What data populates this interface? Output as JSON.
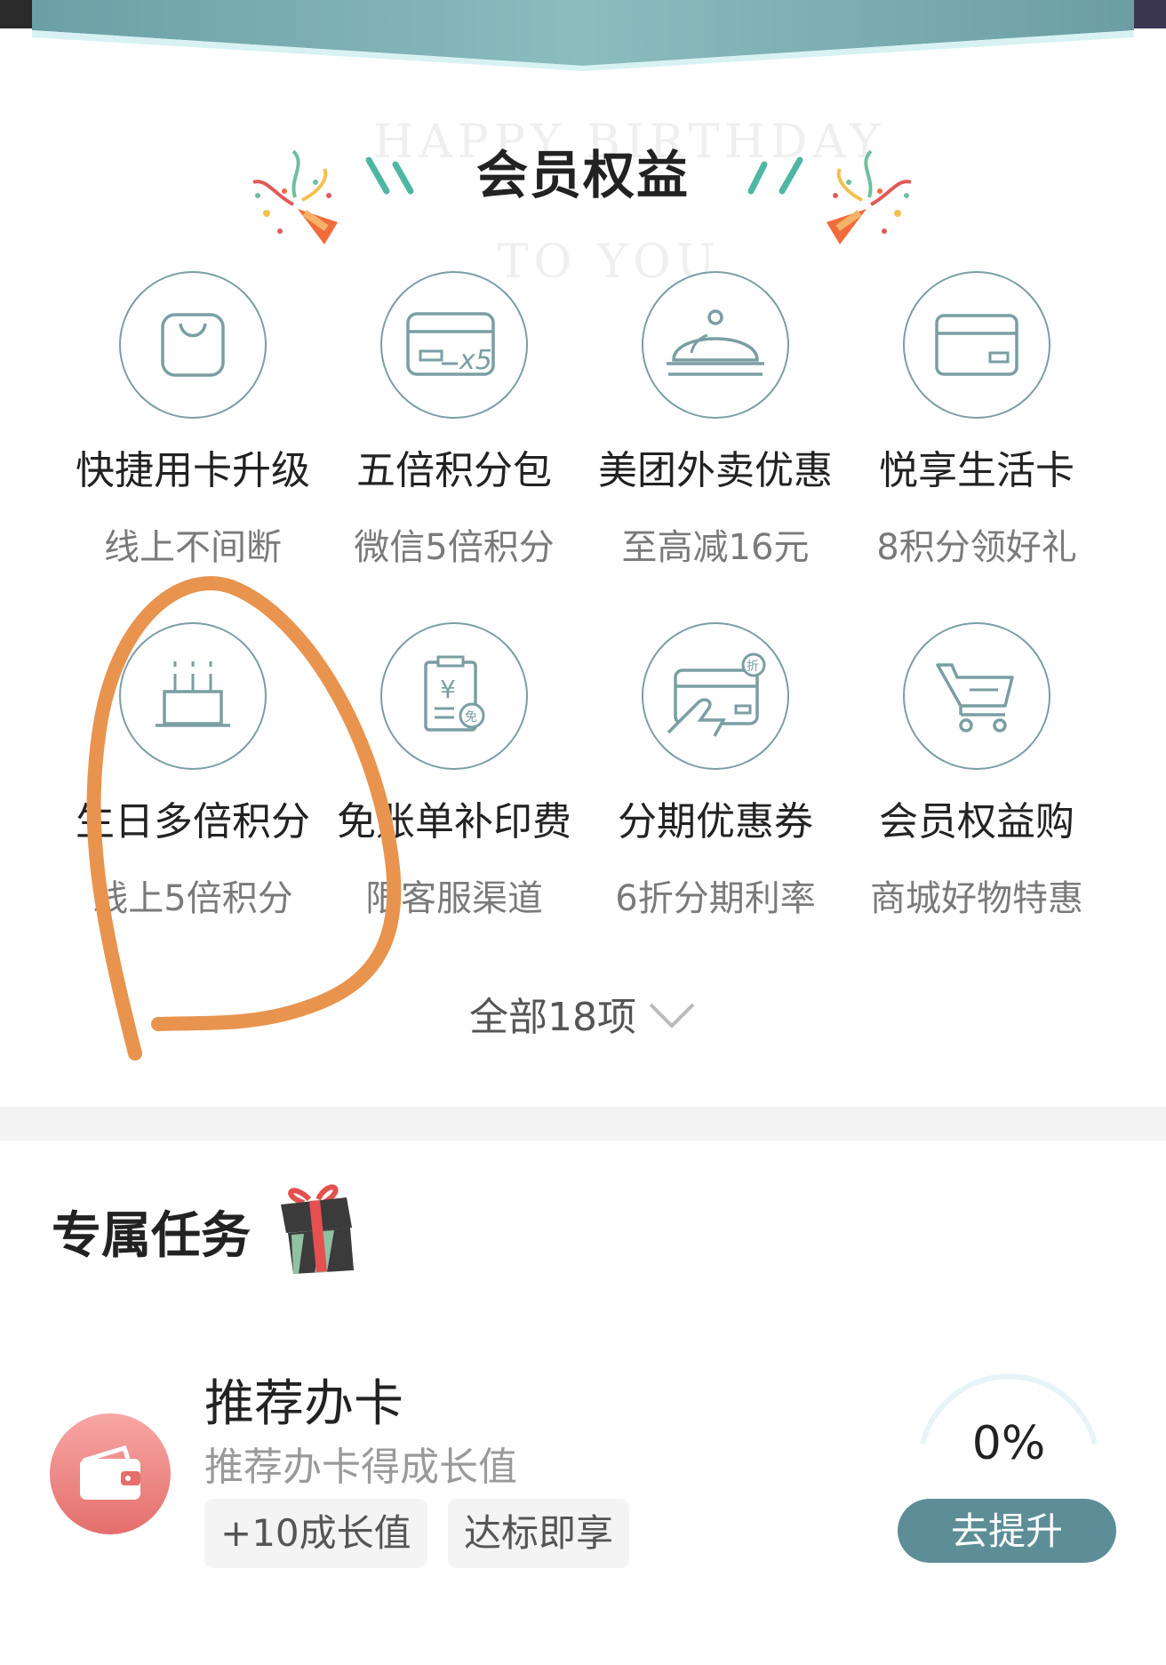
{
  "header": {
    "title": "会员权益",
    "bg_text_line1": "HAPPY BIRTHDAY",
    "bg_text_line2": "TO YOU"
  },
  "benefits": [
    {
      "name": "快捷用卡升级",
      "desc": "线上不间断",
      "icon": "shopping-bag-icon"
    },
    {
      "name": "五倍积分包",
      "desc": "微信5倍积分",
      "icon": "card-x5-icon"
    },
    {
      "name": "美团外卖优惠",
      "desc": "至高减16元",
      "icon": "food-cloche-icon"
    },
    {
      "name": "悦享生活卡",
      "desc": "8积分领好礼",
      "icon": "card-icon"
    },
    {
      "name": "生日多倍积分",
      "desc": "线上5倍积分",
      "icon": "birthday-cake-icon"
    },
    {
      "name": "免账单补印费",
      "desc": "限客服渠道",
      "icon": "bill-clipboard-icon"
    },
    {
      "name": "分期优惠券",
      "desc": "6折分期利率",
      "icon": "card-hand-discount-icon"
    },
    {
      "name": "会员权益购",
      "desc": "商城好物特惠",
      "icon": "shopping-cart-icon"
    }
  ],
  "all_items_label": "全部18项",
  "card_x5_text": "x5",
  "cake_symbol": "¥",
  "discount_symbol": "折",
  "waive_symbol": "免",
  "tasks": {
    "title": "专属任务",
    "items": [
      {
        "name": "推荐办卡",
        "subtitle": "推荐办卡得成长值",
        "tags": [
          "+10成长值",
          "达标即享"
        ],
        "progress_label": "0%",
        "progress": 0,
        "button_label": "去提升"
      }
    ]
  },
  "colors": {
    "accent": "#5d8e97",
    "icon_stroke": "#7a9ea3",
    "banner": "#7fb3b5",
    "annotation": "#e8944f"
  }
}
